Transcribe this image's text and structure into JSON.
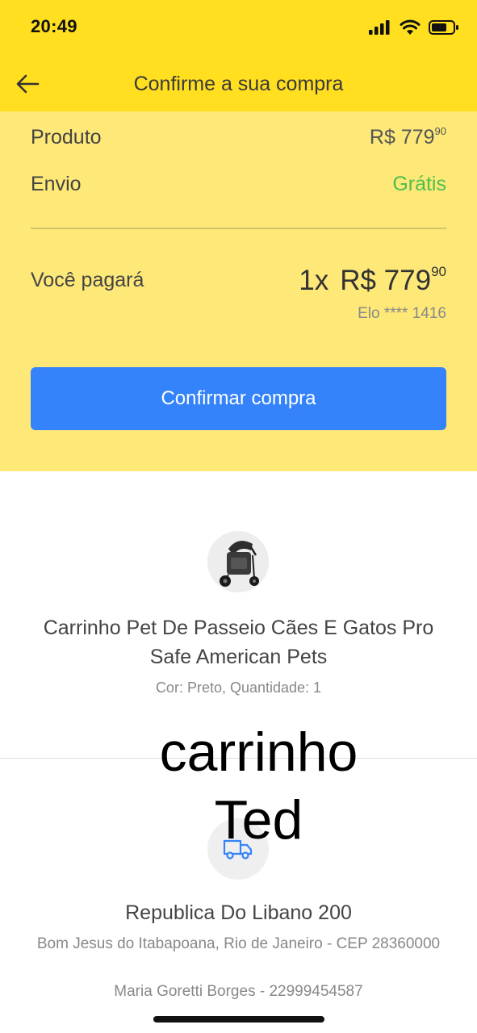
{
  "status_bar": {
    "time": "20:49"
  },
  "header": {
    "title": "Confirme a sua compra"
  },
  "summary": {
    "product_label": "Produto",
    "product_price_main": "R$ 779",
    "product_price_cents": "90",
    "shipping_label": "Envio",
    "shipping_value": "Grátis",
    "pay_label": "Você pagará",
    "pay_qty": "1x",
    "pay_price_main": "R$ 779",
    "pay_price_cents": "90",
    "pay_card": "Elo **** 1416",
    "confirm_button": "Confirmar compra"
  },
  "product": {
    "name": "Carrinho Pet De Passeio Cães E Gatos Pro Safe American Pets",
    "meta": "Cor: Preto, Quantidade: 1"
  },
  "overlay": {
    "line1": "carrinho",
    "line2": "Ted"
  },
  "address": {
    "street": "Republica Do Libano 200",
    "city": "Bom Jesus do Itabapoana, Rio de Janeiro - CEP 28360000",
    "contact": "Maria Goretti Borges - 22999454587"
  },
  "colors": {
    "brand_yellow": "#FFDF1F",
    "summary_bg": "#FDE878",
    "button_blue": "#3483FA",
    "free_green": "#4FBF4F"
  }
}
